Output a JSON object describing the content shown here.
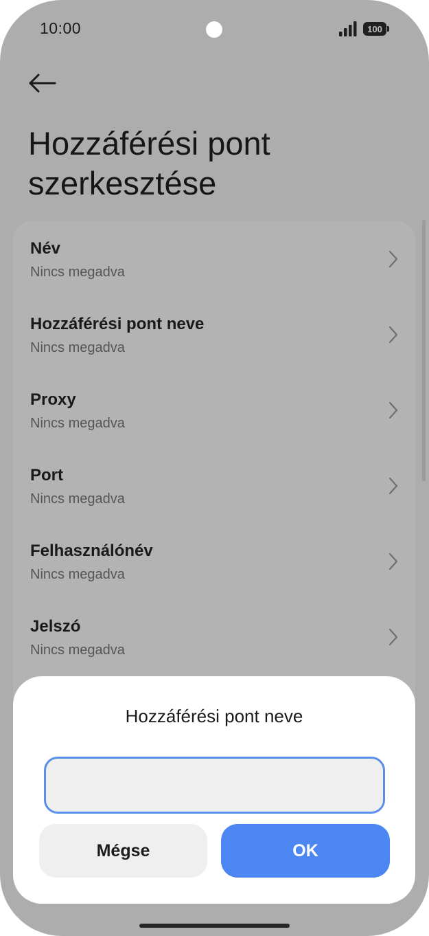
{
  "status_bar": {
    "time": "10:00",
    "battery": "100",
    "icons": [
      "signal-icon",
      "battery-icon"
    ]
  },
  "header": {
    "back_icon": "arrow-left-icon",
    "title_line1": "Hozzáférési pont",
    "title_line2": "szerkesztése"
  },
  "settings": {
    "items": [
      {
        "label": "Név",
        "value": "Nincs megadva"
      },
      {
        "label": "Hozzáférési pont neve",
        "value": "Nincs megadva"
      },
      {
        "label": "Proxy",
        "value": "Nincs megadva"
      },
      {
        "label": "Port",
        "value": "Nincs megadva"
      },
      {
        "label": "Felhasználónév",
        "value": "Nincs megadva"
      },
      {
        "label": "Jelszó",
        "value": "Nincs megadva"
      }
    ]
  },
  "dialog": {
    "title": "Hozzáférési pont neve",
    "input_value": "",
    "cancel_label": "Mégse",
    "ok_label": "OK"
  },
  "colors": {
    "accent": "#4c86f3",
    "input_border": "#5a8fe8",
    "scrim_background": "#adadad"
  }
}
